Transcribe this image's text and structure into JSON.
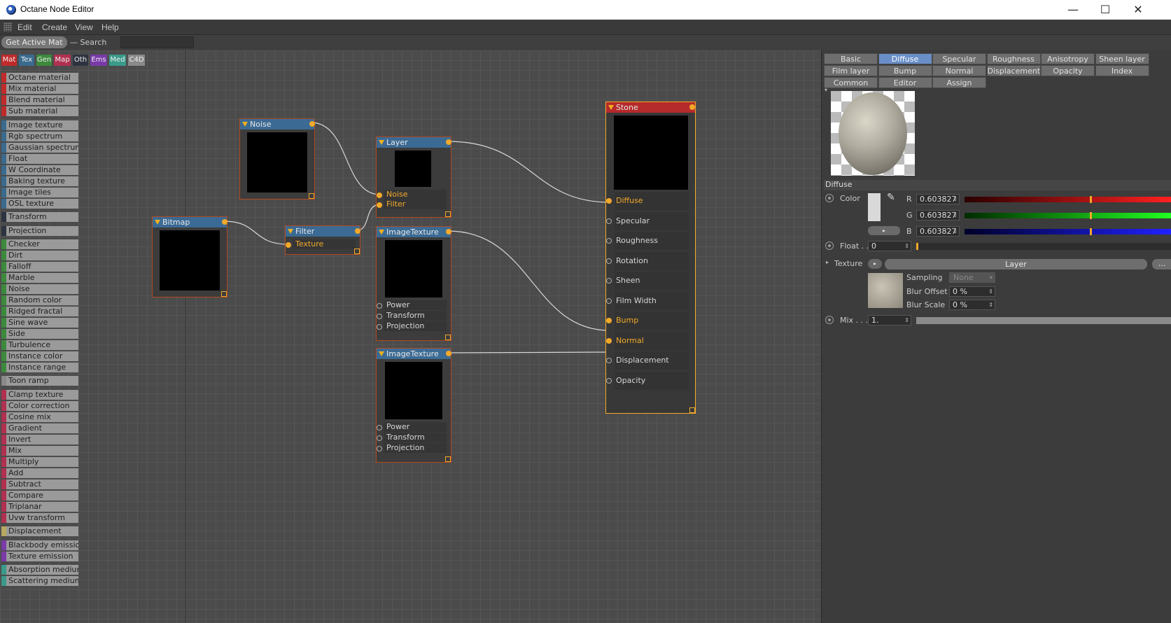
{
  "window": {
    "title": "Octane Node Editor",
    "minimize": "—",
    "maximize": "☐",
    "close": "✕"
  },
  "menu": [
    "Edit",
    "Create",
    "View",
    "Help"
  ],
  "toolbar": {
    "get_active_mat": "Get Active Mat",
    "search_label": "Search",
    "search_value": ""
  },
  "categories": [
    {
      "label": "Mat",
      "color": "#c02a2a"
    },
    {
      "label": "Tex",
      "color": "#3a6a8e"
    },
    {
      "label": "Gen",
      "color": "#3c8a3c"
    },
    {
      "label": "Map",
      "color": "#b03050"
    },
    {
      "label": "Oth",
      "color": "#2d3340"
    },
    {
      "label": "Ems",
      "color": "#7a3aa8"
    },
    {
      "label": "Med",
      "color": "#3a9a8a"
    },
    {
      "label": "C4D",
      "color": "#8a8a8a"
    }
  ],
  "palette": [
    {
      "label": "Octane material",
      "color": "#c02a2a"
    },
    {
      "label": "Mix material",
      "color": "#c02a2a"
    },
    {
      "label": "Blend material",
      "color": "#c02a2a"
    },
    {
      "label": "Sub material",
      "color": "#c02a2a"
    },
    {
      "label": "Image texture",
      "color": "#3a6a8e"
    },
    {
      "label": "Rgb spectrum",
      "color": "#3a6a8e"
    },
    {
      "label": "Gaussian spectrum",
      "color": "#3a6a8e"
    },
    {
      "label": "Float",
      "color": "#3a6a8e"
    },
    {
      "label": "W Coordinate",
      "color": "#3a6a8e"
    },
    {
      "label": "Baking texture",
      "color": "#3a6a8e"
    },
    {
      "label": "Image tiles",
      "color": "#3a6a8e"
    },
    {
      "label": "OSL texture",
      "color": "#3a6a8e"
    },
    {
      "label": "Transform",
      "color": "#2d3340"
    },
    {
      "label": "Projection",
      "color": "#2d3340"
    },
    {
      "label": "Checker",
      "color": "#3c8a3c"
    },
    {
      "label": "Dirt",
      "color": "#3c8a3c"
    },
    {
      "label": "Falloff",
      "color": "#3c8a3c"
    },
    {
      "label": "Marble",
      "color": "#3c8a3c"
    },
    {
      "label": "Noise",
      "color": "#3c8a3c"
    },
    {
      "label": "Random color",
      "color": "#3c8a3c"
    },
    {
      "label": "Ridged fractal",
      "color": "#3c8a3c"
    },
    {
      "label": "Sine wave",
      "color": "#3c8a3c"
    },
    {
      "label": "Side",
      "color": "#3c8a3c"
    },
    {
      "label": "Turbulence",
      "color": "#3c8a3c"
    },
    {
      "label": "Instance color",
      "color": "#3c8a3c"
    },
    {
      "label": "Instance range",
      "color": "#3c8a3c"
    },
    {
      "label": "Toon ramp",
      "color": "#8a8a8a"
    },
    {
      "label": "Clamp texture",
      "color": "#b03050"
    },
    {
      "label": "Color correction",
      "color": "#b03050"
    },
    {
      "label": "Cosine mix",
      "color": "#b03050"
    },
    {
      "label": "Gradient",
      "color": "#b03050"
    },
    {
      "label": "Invert",
      "color": "#b03050"
    },
    {
      "label": "Mix",
      "color": "#b03050"
    },
    {
      "label": "Multiply",
      "color": "#b03050"
    },
    {
      "label": "Add",
      "color": "#b03050"
    },
    {
      "label": "Subtract",
      "color": "#b03050"
    },
    {
      "label": "Compare",
      "color": "#b03050"
    },
    {
      "label": "Triplanar",
      "color": "#b03050"
    },
    {
      "label": "Uvw transform",
      "color": "#b03050"
    },
    {
      "label": "Displacement",
      "color": "#b8a860"
    },
    {
      "label": "Blackbody emission",
      "color": "#7a3aa8"
    },
    {
      "label": "Texture emission",
      "color": "#7a3aa8"
    },
    {
      "label": "Absorption medium",
      "color": "#3a9a8a"
    },
    {
      "label": "Scattering medium",
      "color": "#3a9a8a"
    }
  ],
  "nodes": {
    "noise": {
      "title": "Noise"
    },
    "bitmap": {
      "title": "Bitmap"
    },
    "filter": {
      "title": "Filter",
      "pins": [
        "Texture"
      ]
    },
    "layer": {
      "title": "Layer",
      "pins": [
        "Noise",
        "Filter"
      ]
    },
    "imagetex1": {
      "title": "ImageTexture",
      "pins": [
        "Power",
        "Transform",
        "Projection"
      ]
    },
    "imagetex2": {
      "title": "ImageTexture",
      "pins": [
        "Power",
        "Transform",
        "Projection"
      ]
    },
    "stone": {
      "title": "Stone",
      "pins": [
        "Diffuse",
        "Specular",
        "Roughness",
        "Rotation",
        "Sheen",
        "Film Width",
        "Bump",
        "Normal",
        "Displacement",
        "Opacity"
      ]
    }
  },
  "panel": {
    "tabs_row1": [
      "Basic",
      "Diffuse",
      "Specular",
      "Roughness",
      "Anisotropy",
      "Sheen layer"
    ],
    "tabs_row2": [
      "Film layer",
      "Bump",
      "Normal",
      "Displacement",
      "Opacity",
      "Index"
    ],
    "tabs_row3": [
      "Common",
      "Editor",
      "Assign"
    ],
    "selected_tab": "Diffuse",
    "section": "Diffuse",
    "color_label": "Color",
    "r_label": "R",
    "r_value": "0.603827",
    "g_label": "G",
    "g_value": "0.603827",
    "b_label": "B",
    "b_value": "0.603827",
    "color_level": 0.603827,
    "float_label": "Float . .",
    "float_value": "0",
    "texture_label": "Texture",
    "texture_value": "Layer",
    "more": "...",
    "sampling_label": "Sampling",
    "sampling_value": "None",
    "blur_offset_label": "Blur Offset",
    "blur_offset_value": "0 %",
    "blur_scale_label": "Blur Scale",
    "blur_scale_value": "0 %",
    "mix_label": "Mix . . .",
    "mix_value": "1.",
    "mix_level": 1.0
  }
}
